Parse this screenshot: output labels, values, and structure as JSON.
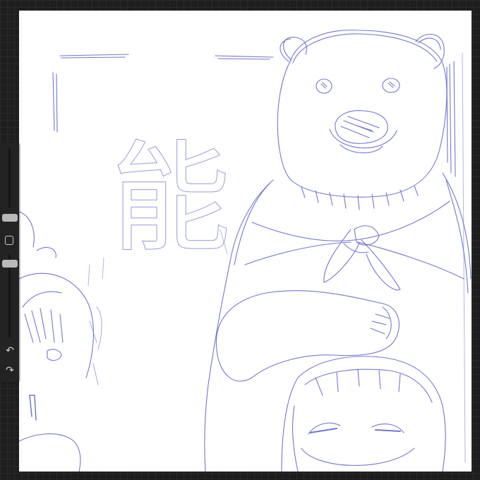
{
  "app": {
    "name": "sketch-canvas-view",
    "background_color": "#1e1e1e",
    "canvas_color": "#ffffff",
    "sketch_color": "#5a5fc8"
  },
  "sidebar": {
    "brush_size_slider": {
      "level_percent": 75
    },
    "opacity_slider": {
      "level_percent": 60
    },
    "modify_button_icon": "square-outline-icon",
    "undo_icon": "undo-arrow-icon",
    "redo_icon": "redo-arrow-icon",
    "undo_glyph": "↶",
    "redo_glyph": "↷"
  },
  "canvas": {
    "sign_character": "能"
  }
}
